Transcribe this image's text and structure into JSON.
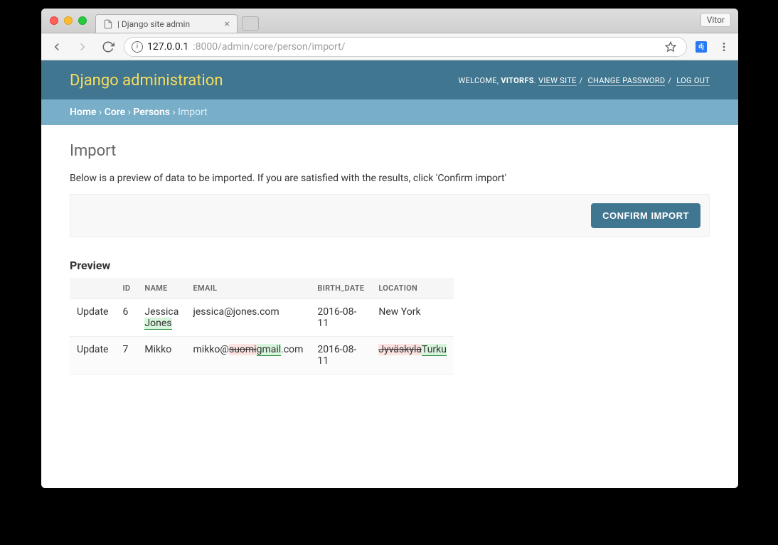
{
  "browser": {
    "tab_title": "| Django site admin",
    "profile_name": "Vitor",
    "url_host": "127.0.0.1",
    "url_port_path": ":8000/admin/core/person/import/"
  },
  "header": {
    "site_title": "Django administration",
    "welcome_label": "WELCOME,",
    "username": "VITORFS",
    "view_site": "VIEW SITE",
    "change_password": "CHANGE PASSWORD",
    "log_out": "LOG OUT"
  },
  "breadcrumbs": {
    "home": "Home",
    "core": "Core",
    "persons": "Persons",
    "current": "Import"
  },
  "page": {
    "title": "Import",
    "intro": "Below is a preview of data to be imported. If you are satisfied with the results, click 'Confirm import'",
    "confirm_button": "CONFIRM IMPORT",
    "preview_heading": "Preview"
  },
  "table": {
    "headers": {
      "action": "",
      "id": "ID",
      "name": "NAME",
      "email": "EMAIL",
      "birth_date": "BIRTH_DATE",
      "location": "LOCATION"
    },
    "rows": [
      {
        "action": "Update",
        "id": "6",
        "name_base": "Jessica",
        "name_ins": " Jones",
        "email_pre": "jessica@jones.com",
        "birth_date": "2016-08-11",
        "location_text": "New York"
      },
      {
        "action": "Update",
        "id": "7",
        "name_base": "Mikko",
        "email_pre": "mikko@",
        "email_del": "suomi",
        "email_ins": "gmail",
        "email_post": ".com",
        "birth_date": "2016-08-11",
        "location_del": "Jyväskyla",
        "location_ins": "Turku"
      }
    ]
  }
}
